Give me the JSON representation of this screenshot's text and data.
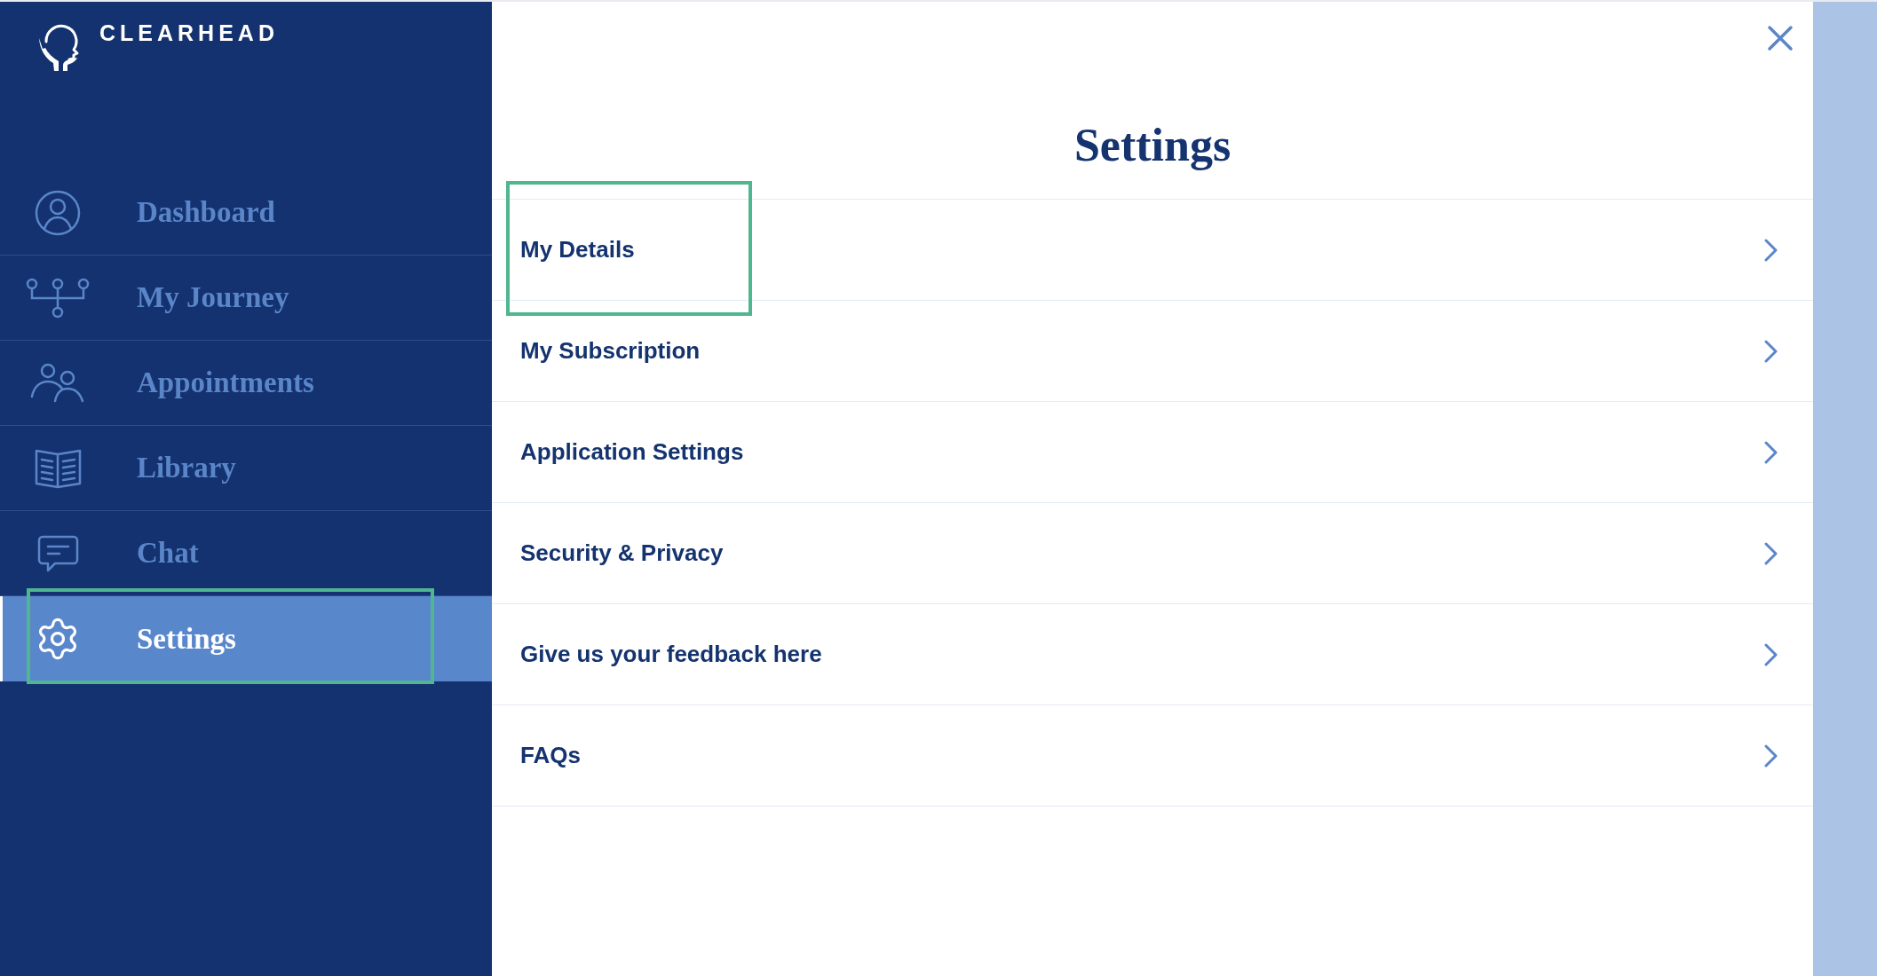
{
  "sidebar": {
    "brand": "CLEARHEAD",
    "items": [
      {
        "label": "Dashboard",
        "selected": false,
        "highlighted": false
      },
      {
        "label": "My Journey",
        "selected": false,
        "highlighted": false
      },
      {
        "label": "Appointments",
        "selected": false,
        "highlighted": false
      },
      {
        "label": "Library",
        "selected": false,
        "highlighted": false
      },
      {
        "label": "Chat",
        "selected": false,
        "highlighted": false
      },
      {
        "label": "Settings",
        "selected": true,
        "highlighted": true
      }
    ]
  },
  "panel": {
    "title": "Settings",
    "items": [
      {
        "label": "My Details",
        "highlighted": true
      },
      {
        "label": "My Subscription",
        "highlighted": false
      },
      {
        "label": "Application Settings",
        "highlighted": false
      },
      {
        "label": "Security & Privacy",
        "highlighted": false
      },
      {
        "label": "Give us your feedback here",
        "highlighted": false
      },
      {
        "label": "FAQs",
        "highlighted": false
      }
    ]
  }
}
